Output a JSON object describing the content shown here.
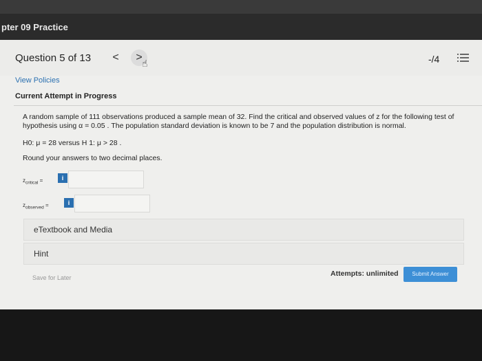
{
  "topbar": {
    "title": "pter 09 Practice"
  },
  "header": {
    "question_label": "Question 5 of 13",
    "prev_glyph": "<",
    "next_glyph": ">",
    "score": "-/4"
  },
  "content": {
    "view_policies": "View Policies",
    "attempt_label": "Current Attempt in Progress",
    "question_text": "A random sample of 111 observations produced a sample mean of 32. Find the critical and observed values of z for the following test of hypothesis using α = 0.05 . The population standard deviation is known to be 7 and the population distribution is normal.",
    "hypothesis": "H0:  μ = 28 versus H 1:  μ > 28 .",
    "round_note": "Round your answers to two decimal places.",
    "z_critical_label": "z",
    "z_critical_sub": "critical",
    "z_observed_label": "z",
    "z_observed_sub": "observed",
    "eq_suffix": " =",
    "info_glyph": "i",
    "z_critical_value": "",
    "z_observed_value": ""
  },
  "panels": {
    "etextbook": "eTextbook and Media",
    "hint": "Hint"
  },
  "footer": {
    "save_later": "Save for Later",
    "attempts": "Attempts: unlimited",
    "submit": "Submit Answer"
  },
  "colors": {
    "link": "#2a6fb0",
    "submit": "#3d8fd6",
    "topbar": "#2b2b2b"
  }
}
